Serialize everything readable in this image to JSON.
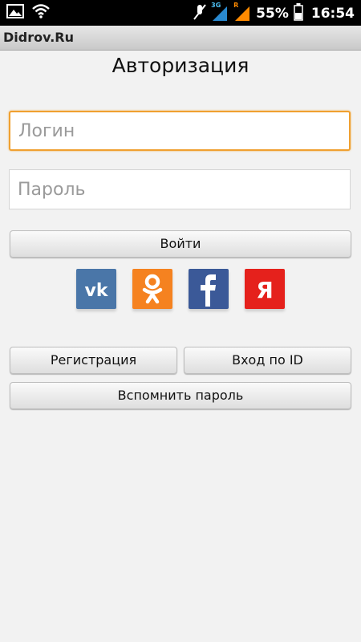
{
  "status_bar": {
    "network_label": "3G",
    "roaming_label": "R",
    "battery": "55%",
    "time": "16:54",
    "icons": [
      "image-icon",
      "wifi-icon",
      "mute-icon",
      "signal-icon",
      "battery-icon"
    ]
  },
  "app": {
    "title": "Didrov.Ru"
  },
  "page": {
    "title": "Авторизация"
  },
  "form": {
    "login_placeholder": "Логин",
    "password_placeholder": "Пароль",
    "submit_label": "Войти"
  },
  "social": [
    {
      "name": "vk-icon",
      "color": "#4a76a8"
    },
    {
      "name": "odnoklassniki-icon",
      "color": "#f58220"
    },
    {
      "name": "facebook-icon",
      "color": "#3b5998"
    },
    {
      "name": "yandex-icon",
      "color": "#e5211c"
    }
  ],
  "actions": {
    "register_label": "Регистрация",
    "id_login_label": "Вход по ID",
    "recover_label": "Вспомнить пароль"
  },
  "colors": {
    "focus_border": "#f0a030",
    "background": "#f2f2f2"
  }
}
